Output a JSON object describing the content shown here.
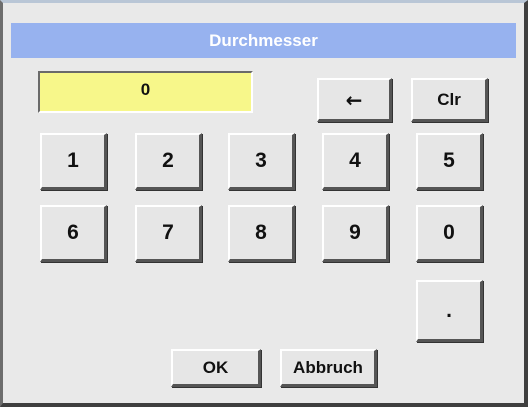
{
  "dialog": {
    "title": "Durchmesser",
    "display_value": "0"
  },
  "keypad": {
    "backspace_label": "←",
    "backspace_icon": "left-arrow-icon",
    "clear_label": "Clr",
    "row1": [
      "1",
      "2",
      "3",
      "4",
      "5"
    ],
    "row2": [
      "6",
      "7",
      "8",
      "9",
      "0"
    ],
    "dot_label": "."
  },
  "actions": {
    "ok_label": "OK",
    "cancel_label": "Abbruch"
  },
  "colors": {
    "titlebar": "#97b2ef",
    "display": "#f7f78a",
    "background": "#e9e9e9"
  }
}
